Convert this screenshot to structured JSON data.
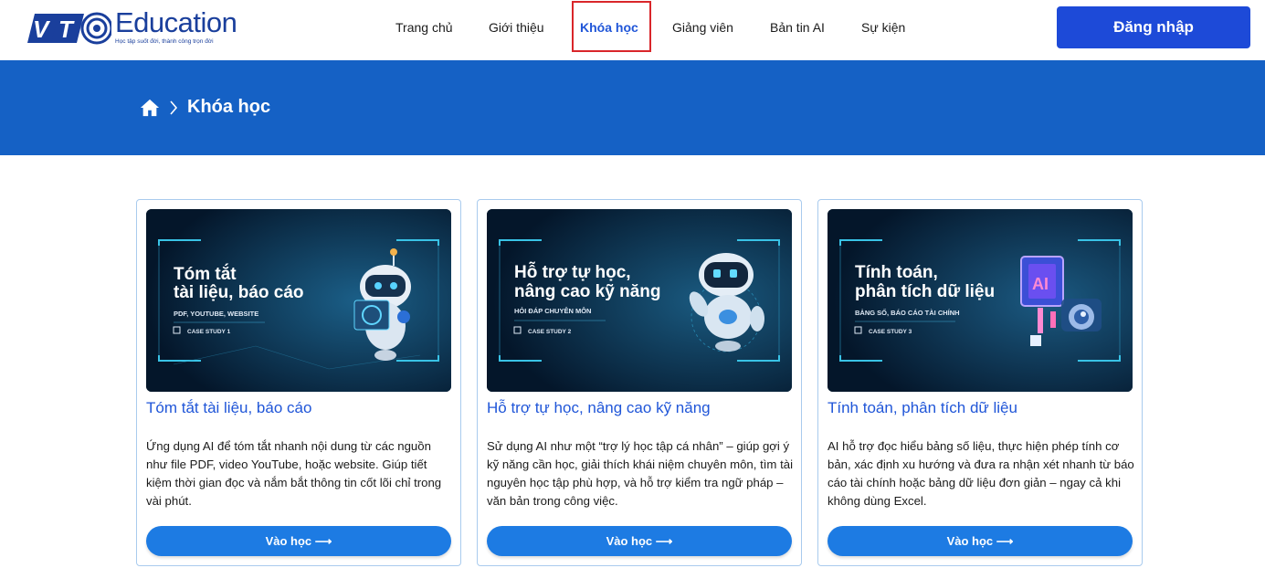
{
  "header": {
    "logo": {
      "brand_short": "VTC",
      "brand": "Education",
      "tagline": "Học tập suốt đời, thành công trọn đời"
    },
    "nav": [
      {
        "label": "Trang chủ",
        "active": false
      },
      {
        "label": "Giới thiệu",
        "active": false
      },
      {
        "label": "Khóa học",
        "active": true
      },
      {
        "label": "Giảng viên",
        "active": false
      },
      {
        "label": "Bản tin AI",
        "active": false
      },
      {
        "label": "Sự kiện",
        "active": false
      }
    ],
    "login_label": "Đăng nhập"
  },
  "banner": {
    "home_icon": "home-icon",
    "separator_icon": "chevron-right-icon",
    "current": "Khóa học"
  },
  "courses": [
    {
      "image": {
        "title_line1": "Tóm tắt",
        "title_line2": "tài liệu, báo cáo",
        "subtitle": "PDF, YOUTUBE, WEBSITE",
        "case": "CASE STUDY 1"
      },
      "title": "Tóm tắt tài liệu, báo cáo",
      "description": "Ứng dụng AI để tóm tắt nhanh nội dung từ các nguồn như file PDF, video YouTube, hoặc website. Giúp tiết kiệm thời gian đọc và nắm bắt thông tin cốt lõi chỉ trong vài phút.",
      "button": "Vào học ⟶"
    },
    {
      "image": {
        "title_line1": "Hỗ trợ tự học,",
        "title_line2": "nâng cao kỹ năng",
        "subtitle": "HỎI ĐÁP CHUYÊN MÔN",
        "case": "CASE STUDY 2"
      },
      "title": "Hỗ trợ tự học, nâng cao kỹ năng",
      "description": "Sử dụng AI như một “trợ lý học tập cá nhân” – giúp gợi ý kỹ năng cần học, giải thích khái niệm chuyên môn, tìm tài nguyên học tập phù hợp, và hỗ trợ kiểm tra ngữ pháp – văn bản trong công việc.",
      "button": "Vào học ⟶"
    },
    {
      "image": {
        "title_line1": "Tính toán,",
        "title_line2": "phân tích dữ liệu",
        "subtitle": "BẢNG SỐ, BÁO CÁO TÀI CHÍNH",
        "case": "CASE STUDY 3",
        "badge": "AI"
      },
      "title": "Tính toán, phân tích dữ liệu",
      "description": "AI hỗ trợ đọc hiểu bảng số liệu, thực hiện phép tính cơ bản, xác định xu hướng và đưa ra nhận xét nhanh từ báo cáo tài chính hoặc bảng dữ liệu đơn giản – ngay cả khi không dùng Excel.",
      "button": "Vào học ⟶"
    }
  ],
  "colors": {
    "brand_blue": "#1d4ad8",
    "banner_blue": "#1561c5",
    "link_blue": "#2056d8",
    "button_blue": "#1d7be3",
    "active_outline": "#d9262a"
  }
}
